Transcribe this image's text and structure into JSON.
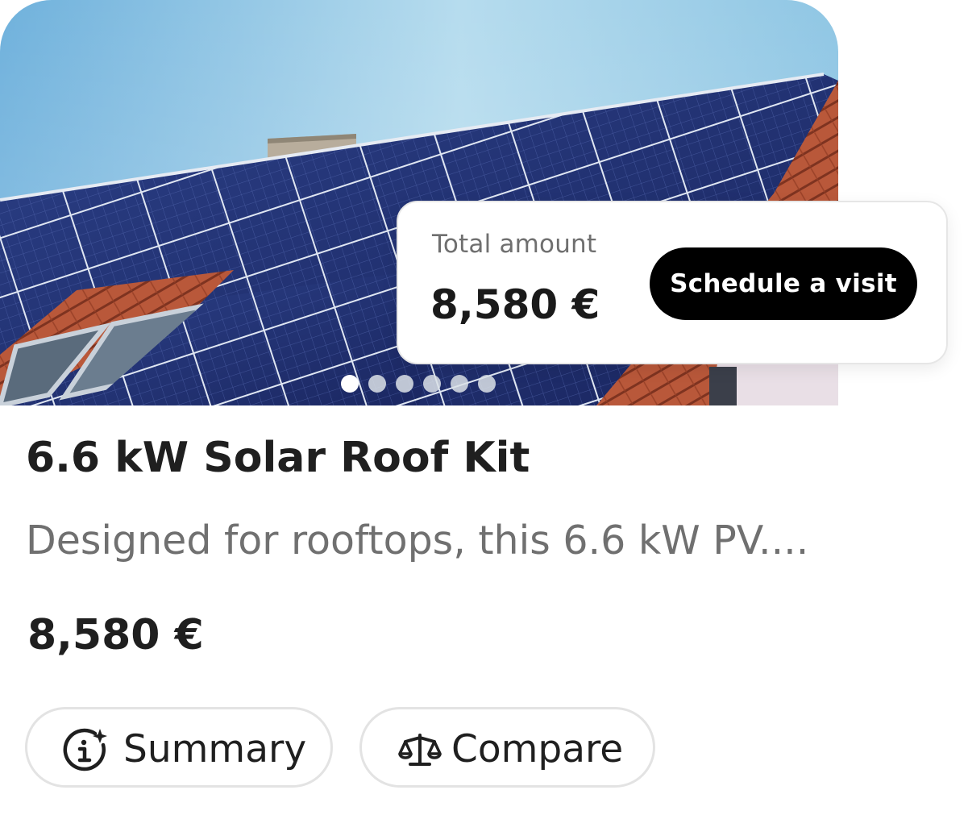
{
  "product": {
    "title": "6.6 kW Solar Roof Kit",
    "description": "Designed for rooftops, this 6.6 kW PV....",
    "price": "8,580 €"
  },
  "amount_card": {
    "label": "Total amount",
    "value": "8,580 €",
    "cta_label": "Schedule a visit"
  },
  "carousel": {
    "total_slides": 6,
    "active_index": 0
  },
  "actions": {
    "summary_label": "Summary",
    "summary_icon": "info-sparkle-icon",
    "compare_label": "Compare",
    "compare_icon": "scale-balance-icon"
  },
  "colors": {
    "cta_background": "#000000",
    "cta_text": "#ffffff",
    "muted_text": "#707070",
    "pill_border": "#e3e3e3"
  }
}
